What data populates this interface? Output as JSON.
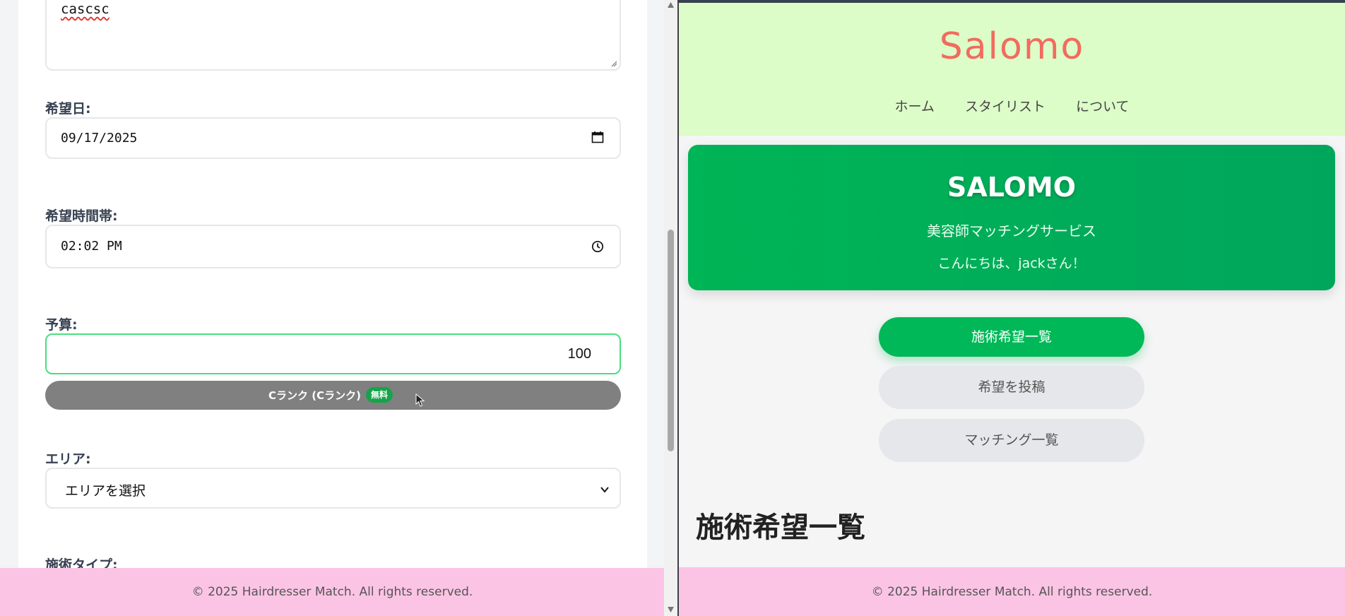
{
  "form": {
    "description_value": "cascsc",
    "date_label": "希望日:",
    "date_value": "09/17/2025",
    "time_label": "希望時間帯:",
    "time_value": "02:02 PM",
    "budget_label": "予算:",
    "budget_value": "100",
    "rank_text": "Cランク (Cランク)",
    "rank_badge": "無料",
    "area_label": "エリア:",
    "area_selected": "エリアを選択",
    "type_label": "施術タイプ:"
  },
  "footer": {
    "copyright": "© 2025 Hairdresser Match. All rights reserved."
  },
  "site": {
    "logo": "Salomo",
    "nav": [
      "ホーム",
      "スタイリスト",
      "について"
    ]
  },
  "hero": {
    "title": "SALOMO",
    "subtitle": "美容師マッチングサービス",
    "greeting": "こんにちは、jackさん！"
  },
  "actions": {
    "requests": "施術希望一覧",
    "post": "希望を投稿",
    "matching": "マッチング一覧"
  },
  "section": {
    "title": "施術希望一覧"
  },
  "colors": {
    "header_bg": "#dcfcc8",
    "logo": "#f26b5e",
    "accent_green": "#00b857",
    "footer_pink": "#fbc4e4",
    "rank_grey": "#808080"
  },
  "icons": [
    "calendar-icon",
    "clock-icon",
    "chevron-down-icon",
    "cursor-icon",
    "resize-grip-icon",
    "scroll-up-arrow-icon",
    "scroll-down-arrow-icon"
  ]
}
